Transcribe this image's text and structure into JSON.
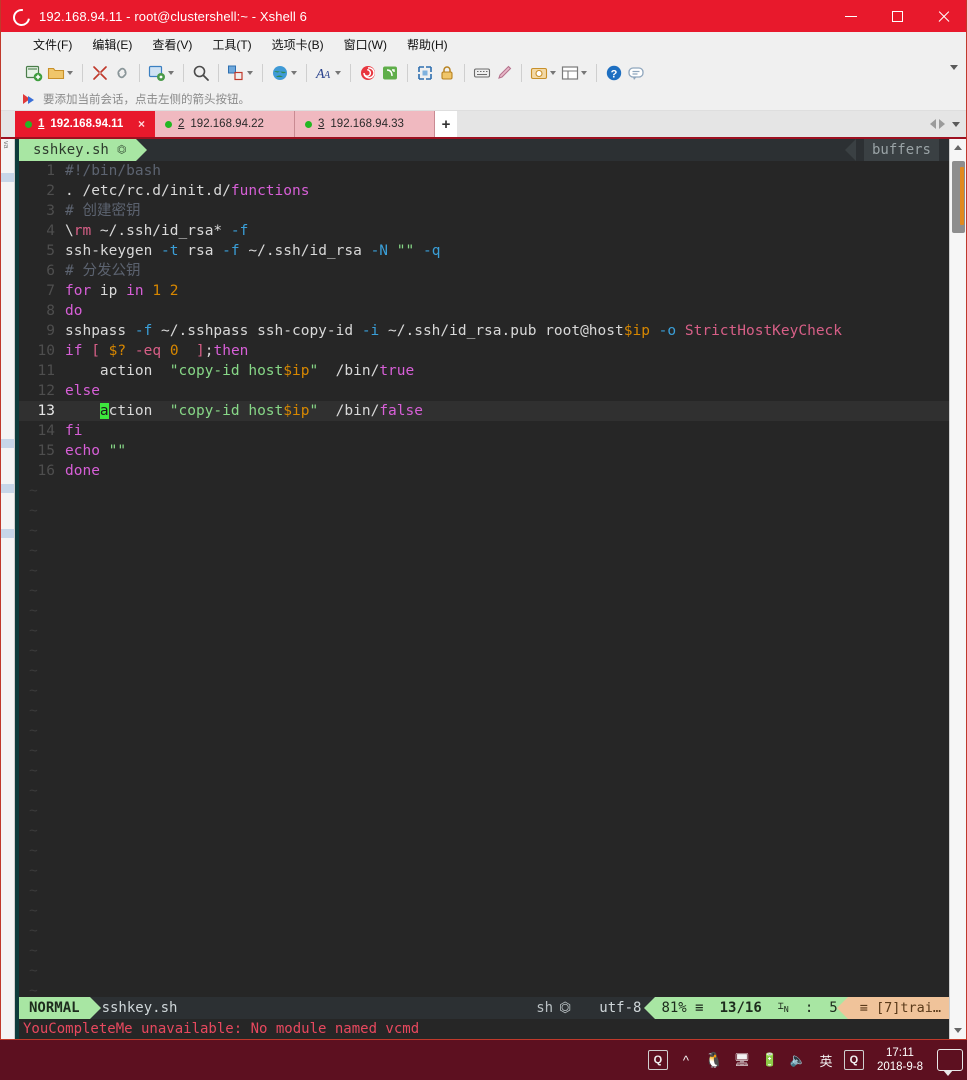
{
  "window": {
    "title": "192.168.94.11 - root@clustershell:~ - Xshell 6",
    "logo_icon": "xshell-logo-icon",
    "minimize_label": "Minimize",
    "maximize_label": "Maximize",
    "close_label": "Close"
  },
  "menu": {
    "items": [
      {
        "label": "文件(F)",
        "name": "menu-file"
      },
      {
        "label": "编辑(E)",
        "name": "menu-edit"
      },
      {
        "label": "查看(V)",
        "name": "menu-view"
      },
      {
        "label": "工具(T)",
        "name": "menu-tools"
      },
      {
        "label": "选项卡(B)",
        "name": "menu-tabs"
      },
      {
        "label": "窗口(W)",
        "name": "menu-window"
      },
      {
        "label": "帮助(H)",
        "name": "menu-help"
      }
    ]
  },
  "toolbar": {
    "overflow_label": "More toolbar buttons",
    "buttons": [
      {
        "icon": "new-session-icon",
        "caret": false
      },
      {
        "icon": "open-folder-icon",
        "caret": true
      },
      {
        "sep": true
      },
      {
        "icon": "disconnect-icon",
        "caret": false
      },
      {
        "icon": "reconnect-icon",
        "caret": false
      },
      {
        "sep": true
      },
      {
        "icon": "session-properties-icon",
        "caret": true
      },
      {
        "sep": true
      },
      {
        "icon": "find-icon",
        "caret": false
      },
      {
        "sep": true
      },
      {
        "icon": "file-transfer-icon",
        "caret": true
      },
      {
        "sep": true
      },
      {
        "icon": "globe-icon",
        "caret": true
      },
      {
        "sep": true
      },
      {
        "icon": "font-size-icon",
        "caret": true
      },
      {
        "sep": true
      },
      {
        "icon": "log-icon",
        "caret": false
      },
      {
        "icon": "script-icon",
        "caret": false
      },
      {
        "sep": true
      },
      {
        "icon": "fullscreen-icon",
        "caret": false
      },
      {
        "icon": "lock-icon",
        "caret": false
      },
      {
        "sep": true
      },
      {
        "icon": "keyboard-icon",
        "caret": false
      },
      {
        "icon": "highlight-icon",
        "caret": false
      },
      {
        "sep": true
      },
      {
        "icon": "capture-icon",
        "caret": true
      },
      {
        "icon": "layout-icon",
        "caret": true
      },
      {
        "sep": true
      },
      {
        "icon": "help-icon",
        "caret": false
      },
      {
        "icon": "chat-icon",
        "caret": false
      }
    ]
  },
  "hint": {
    "icon": "add-session-arrow-icon",
    "text": "要添加当前会话，点击左侧的箭头按钮。"
  },
  "tabs": {
    "items": [
      {
        "num": "1",
        "label": "192.168.94.11",
        "active": true,
        "status": "connected"
      },
      {
        "num": "2",
        "label": "192.168.94.22",
        "active": false,
        "status": "connected"
      },
      {
        "num": "3",
        "label": "192.168.94.33",
        "active": false,
        "status": "connected"
      }
    ],
    "close_glyph": "×",
    "add_label": "+",
    "nav_prev": "previous-tab",
    "nav_next": "next-tab",
    "nav_list": "tab-list"
  },
  "editor": {
    "tab_name": "sshkey.sh",
    "tab_modified_icon": "vim-airline-icon",
    "buffers_label": "buffers",
    "cursor": {
      "line": 13,
      "col": 5,
      "char": "a"
    },
    "lines": [
      {
        "n": "1",
        "tokens": [
          {
            "t": "#!/bin/bash",
            "c": "s-cmt"
          }
        ]
      },
      {
        "n": "2",
        "tokens": [
          {
            "t": ". /etc/rc.d/init.d/",
            "c": "s-cmd"
          },
          {
            "t": "functions",
            "c": "s-fn"
          }
        ]
      },
      {
        "n": "3",
        "tokens": [
          {
            "t": "# 创建密钥",
            "c": "s-cmt"
          }
        ]
      },
      {
        "n": "4",
        "tokens": [
          {
            "t": "\\",
            "c": "s-cmd"
          },
          {
            "t": "rm",
            "c": "s-op"
          },
          {
            "t": " ~/.ssh/id_rsa* ",
            "c": "s-cmd"
          },
          {
            "t": "-f",
            "c": "s-flag"
          }
        ]
      },
      {
        "n": "5",
        "tokens": [
          {
            "t": "ssh-keygen ",
            "c": "s-cmd"
          },
          {
            "t": "-t",
            "c": "s-flag"
          },
          {
            "t": " rsa ",
            "c": "s-cmd"
          },
          {
            "t": "-f",
            "c": "s-flag"
          },
          {
            "t": " ~/.ssh/id_rsa ",
            "c": "s-cmd"
          },
          {
            "t": "-N",
            "c": "s-flag"
          },
          {
            "t": " ",
            "c": "s-cmd"
          },
          {
            "t": "\"\"",
            "c": "s-str"
          },
          {
            "t": " ",
            "c": "s-cmd"
          },
          {
            "t": "-q",
            "c": "s-flag"
          }
        ]
      },
      {
        "n": "6",
        "tokens": [
          {
            "t": "# 分发公钥",
            "c": "s-cmt"
          }
        ]
      },
      {
        "n": "7",
        "tokens": [
          {
            "t": "for",
            "c": "s-kw"
          },
          {
            "t": " ip ",
            "c": "s-cmd"
          },
          {
            "t": "in",
            "c": "s-kw"
          },
          {
            "t": " ",
            "c": "s-cmd"
          },
          {
            "t": "1",
            "c": "s-num"
          },
          {
            "t": " ",
            "c": "s-cmd"
          },
          {
            "t": "2",
            "c": "s-num"
          }
        ]
      },
      {
        "n": "8",
        "tokens": [
          {
            "t": "do",
            "c": "s-kw"
          }
        ]
      },
      {
        "n": "9",
        "tokens": [
          {
            "t": "sshpass ",
            "c": "s-cmd"
          },
          {
            "t": "-f",
            "c": "s-flag"
          },
          {
            "t": " ~/.sshpass ssh-copy-id ",
            "c": "s-cmd"
          },
          {
            "t": "-i",
            "c": "s-flag"
          },
          {
            "t": " ~/.ssh/id_rsa.pub root@host",
            "c": "s-cmd"
          },
          {
            "t": "$ip",
            "c": "s-var"
          },
          {
            "t": " ",
            "c": "s-cmd"
          },
          {
            "t": "-o",
            "c": "s-flag"
          },
          {
            "t": " ",
            "c": "s-cmd"
          },
          {
            "t": "StrictHostKeyCheck",
            "c": "s-op"
          }
        ]
      },
      {
        "n": "10",
        "tokens": [
          {
            "t": "if",
            "c": "s-kw"
          },
          {
            "t": " ",
            "c": "s-cmd"
          },
          {
            "t": "[",
            "c": "s-op"
          },
          {
            "t": " ",
            "c": "s-cmd"
          },
          {
            "t": "$?",
            "c": "s-var"
          },
          {
            "t": " ",
            "c": "s-cmd"
          },
          {
            "t": "-eq",
            "c": "s-op"
          },
          {
            "t": " ",
            "c": "s-cmd"
          },
          {
            "t": "0",
            "c": "s-num"
          },
          {
            "t": "  ",
            "c": "s-cmd"
          },
          {
            "t": "]",
            "c": "s-op"
          },
          {
            "t": ";",
            "c": "s-cmd"
          },
          {
            "t": "then",
            "c": "s-kw"
          }
        ]
      },
      {
        "n": "11",
        "tokens": [
          {
            "t": "    action  ",
            "c": "s-cmd"
          },
          {
            "t": "\"copy-id host",
            "c": "s-str"
          },
          {
            "t": "$ip",
            "c": "s-var"
          },
          {
            "t": "\"",
            "c": "s-str"
          },
          {
            "t": "  /bin/",
            "c": "s-cmd"
          },
          {
            "t": "true",
            "c": "s-kw"
          }
        ]
      },
      {
        "n": "12",
        "tokens": [
          {
            "t": "else",
            "c": "s-kw"
          }
        ]
      },
      {
        "n": "13",
        "tokens": [
          {
            "t": "    ",
            "c": "s-cmd"
          },
          {
            "t": "a",
            "c": "cursor"
          },
          {
            "t": "ction  ",
            "c": "s-cmd"
          },
          {
            "t": "\"copy-id host",
            "c": "s-str"
          },
          {
            "t": "$ip",
            "c": "s-var"
          },
          {
            "t": "\"",
            "c": "s-str"
          },
          {
            "t": "  /bin/",
            "c": "s-cmd"
          },
          {
            "t": "false",
            "c": "s-kw"
          }
        ],
        "current": true
      },
      {
        "n": "14",
        "tokens": [
          {
            "t": "fi",
            "c": "s-kw"
          }
        ]
      },
      {
        "n": "15",
        "tokens": [
          {
            "t": "echo",
            "c": "s-kw"
          },
          {
            "t": " ",
            "c": "s-cmd"
          },
          {
            "t": "\"\"",
            "c": "s-str"
          }
        ]
      },
      {
        "n": "16",
        "tokens": [
          {
            "t": "done",
            "c": "s-kw"
          }
        ]
      }
    ],
    "empty_marker": "~",
    "empty_count": 27,
    "status": {
      "mode": "NORMAL",
      "filename": "sshkey.sh",
      "filetype": "sh",
      "filetype_icon": "vim-airline-icon",
      "encoding": "utf-8",
      "percent": "81%",
      "percent_icon": "≡",
      "position": "13/16",
      "position_icon": "⌶",
      "position_icon_sub": "N",
      "colon": ":",
      "column": "5",
      "warning_icon": "≡",
      "warning": "[7]trai…"
    },
    "message": "YouCompleteMe unavailable: No module named vcmd"
  },
  "scrollbar": {
    "up_label": "scroll-up",
    "down_label": "scroll-down",
    "thumb_label": "scroll-thumb"
  },
  "leftdock": {
    "label": "va"
  },
  "taskbar": {
    "search_icon": "search-icon",
    "chevron_icon": "show-hidden-icons-icon",
    "penguin_icon": "qq-penguin-icon",
    "network_icon": "network-icon",
    "battery_icon": "battery-icon",
    "volume_icon": "volume-icon",
    "ime_label": "英",
    "ime_icon": "ime-chinese-icon",
    "app_icon": "app-icon",
    "time": "17:11",
    "date": "2018-9-8",
    "notify_icon": "notifications-icon"
  },
  "colors": {
    "accent_red": "#e8192c",
    "vim_green": "#a8e6a3",
    "vim_bg": "#262626",
    "taskbar": "#5d1020",
    "cursor_green": "#3de83d",
    "warn_orange": "#f0c39a"
  }
}
